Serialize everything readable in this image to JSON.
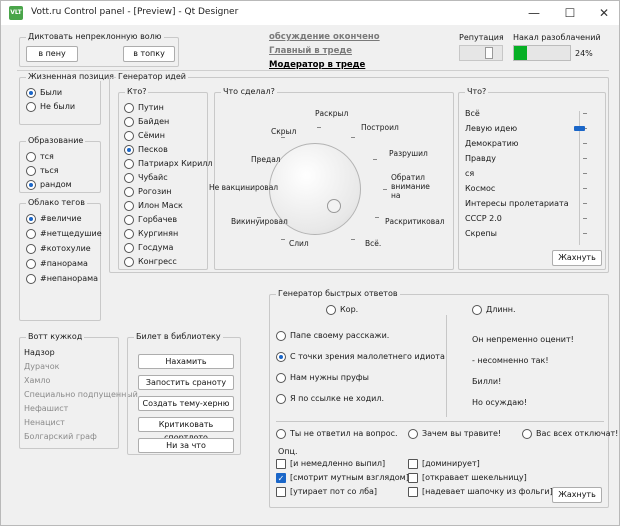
{
  "window": {
    "title": "Vott.ru Control panel - [Preview] - Qt Designer",
    "app_icon_text": "VLT",
    "minimize": "—",
    "maximize": "☐",
    "close": "✕"
  },
  "dictate": {
    "title": "Диктовать непреклонную волю",
    "btn_left": "в пену",
    "btn_right": "в топку"
  },
  "links": {
    "l1": "обсуждение окончено",
    "l2": "Главный в треде",
    "l3": "Модератор в треде"
  },
  "reputation": {
    "label": "Репутация",
    "value": 0.7
  },
  "progress": {
    "label": "Накал разоблачений",
    "value": 24,
    "text": "24%",
    "color": "#06b025"
  },
  "life": {
    "title": "Жизненная позиция",
    "options": [
      "Были",
      "Не были"
    ],
    "selected": 0
  },
  "education": {
    "title": "Образование",
    "options": [
      "тся",
      "ться",
      "рандом"
    ],
    "selected": 2
  },
  "tags": {
    "title": "Облако тегов",
    "options": [
      "#величие",
      "#нетщедушие",
      "#котохулие",
      "#панорама",
      "#непанорама"
    ],
    "selected": 0
  },
  "ideas": {
    "title": "Генератор идей",
    "who": {
      "title": "Кто?",
      "options": [
        "Путин",
        "Байден",
        "Сёмин",
        "Песков",
        "Патриарх Кирилл",
        "Чубайс",
        "Рогозин",
        "Илон Маск",
        "Горбачев",
        "Кургинян",
        "Госдума",
        "Конгресс"
      ],
      "selected": 3
    },
    "what": {
      "title": "Что сделал?",
      "labels": [
        "Раскрыл",
        "Построил",
        "Разрушил",
        "Обратил внимание на",
        "Раскритиковал",
        "Всё.",
        "Слил",
        "Викинуировал",
        "Не вакцинировал",
        "Предал",
        "Скрыл"
      ]
    },
    "whatobj": {
      "title": "Что?",
      "items": [
        "Всё",
        "Левую идею",
        "Демократию",
        "Правду",
        "ся",
        "Космос",
        "Интересы пролетариата",
        "СССР 2.0",
        "Скрепы"
      ],
      "selected": 1
    },
    "button": "Жахнуть"
  },
  "vott": {
    "title": "Вотт кужкод",
    "items": [
      "Надзор",
      "Дурачок",
      "Хамло",
      "Специально подпущенный",
      "Нефашист",
      "Ненацист",
      "Болгарский граф"
    ],
    "active": 0
  },
  "library": {
    "title": "Билет в библиотеку",
    "buttons": [
      "Нахамить",
      "Запостить сраноту",
      "Создать тему-херню",
      "Критиковать спортлото",
      "Ни за что"
    ]
  },
  "quick": {
    "title": "Генератор быстрых ответов",
    "short": "Кор.",
    "long": "Длинн.",
    "short_opts": [
      "Папе своему расскажи.",
      "С точки зрения малолетнего идиота",
      "Нам нужны пруфы",
      "Я по ссылке не ходил."
    ],
    "short_sel": 1,
    "long_texts": [
      "Он непременно оценит!",
      "- несомненно так!",
      "Билли!",
      "Но осуждаю!"
    ],
    "bottom_opts": [
      "Ты не ответил на вопрос.",
      "Зачем вы травите!",
      "Вас всех отключат!"
    ],
    "opts_label": "Опц.",
    "checks": [
      {
        "t": "[и немедленно выпил]",
        "on": false
      },
      {
        "t": "[доминирует]",
        "on": false
      },
      {
        "t": "[смотрит мутным взглядом]",
        "on": true
      },
      {
        "t": "[откравает шекельницу]",
        "on": false
      },
      {
        "t": "[утирает пот со лба]",
        "on": false
      },
      {
        "t": "[надевает шапочку из фольги]",
        "on": false
      }
    ],
    "button": "Жахнуть"
  }
}
